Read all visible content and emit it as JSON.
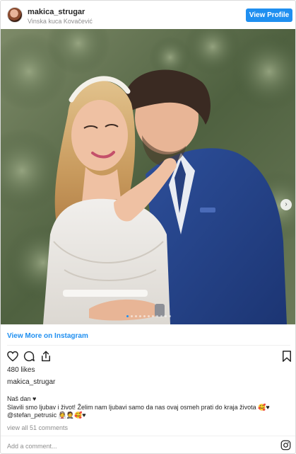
{
  "header": {
    "username": "makica_strugar",
    "location": "Vinska kuca Kovačević",
    "view_profile_label": "View Profile"
  },
  "carousel": {
    "slide_count": 11,
    "active_index": 0
  },
  "view_more_label": "View More on Instagram",
  "actions": {
    "like": "heart-icon",
    "comment": "comment-icon",
    "share": "share-icon",
    "save": "bookmark-icon"
  },
  "likes": "480 likes",
  "owner": "makica_strugar",
  "caption": {
    "line1": "Naš dan ♥",
    "line2": "Slavili smo ljubav i život! Želim nam ljubavi samo da nas ovaj osmeh prati do kraja života 🥰♥",
    "line3": "@stefan_petrusic 👰🤵🥰♥"
  },
  "comments_link": "view all 51 comments",
  "add_comment_placeholder": "Add a comment...",
  "colors": {
    "accent": "#1f8ff0",
    "text": "#262626",
    "muted": "#8e8e8e"
  }
}
